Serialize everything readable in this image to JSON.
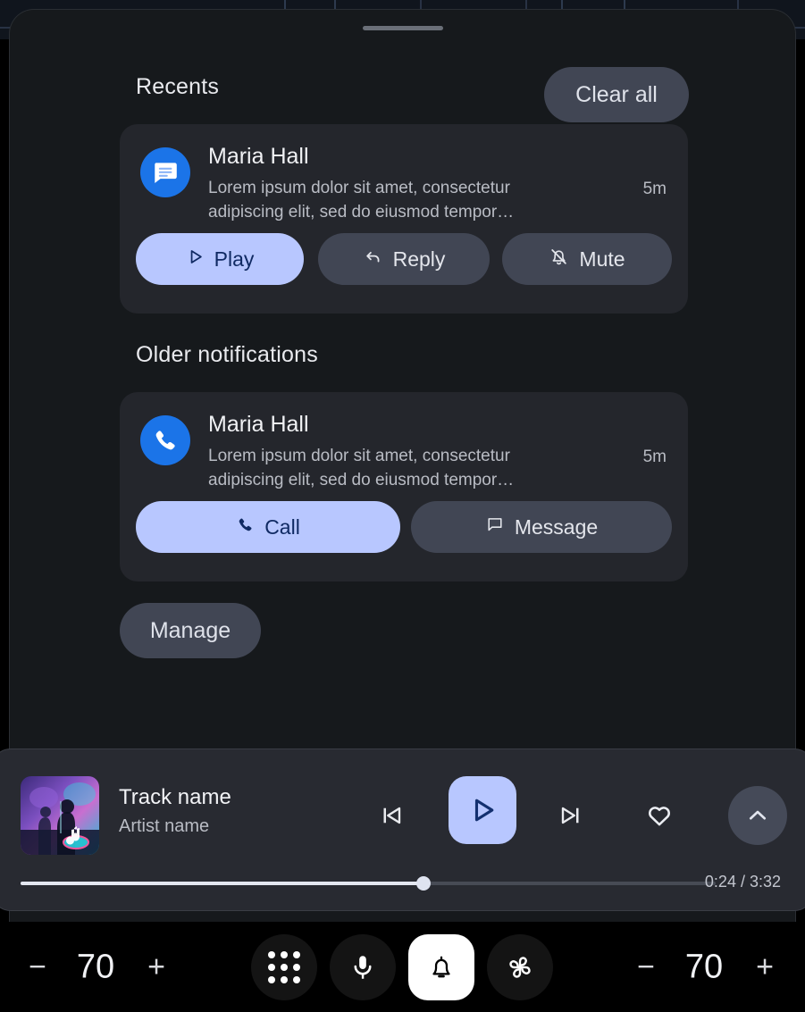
{
  "sheet": {
    "drag_handle": "drag-handle",
    "recents_header": "Recents",
    "clear_all_label": "Clear all",
    "older_header": "Older notifications",
    "manage_label": "Manage"
  },
  "notifications": [
    {
      "group": "Recents",
      "app_icon": "messages-icon",
      "title": "Maria Hall",
      "body": "Lorem ipsum dolor sit amet, consectetur adipiscing elit, sed do eiusmod tempor…",
      "time": "5m",
      "actions": [
        {
          "label": "Play",
          "icon": "play-icon",
          "style": "filled"
        },
        {
          "label": "Reply",
          "icon": "reply-icon",
          "style": "tonal"
        },
        {
          "label": "Mute",
          "icon": "bell-off-icon",
          "style": "tonal"
        }
      ]
    },
    {
      "group": "Older notifications",
      "app_icon": "phone-icon",
      "title": "Maria Hall",
      "body": "Lorem ipsum dolor sit amet, consectetur adipiscing elit, sed do eiusmod tempor…",
      "time": "5m",
      "actions": [
        {
          "label": "Call",
          "icon": "phone-icon",
          "style": "filled"
        },
        {
          "label": "Message",
          "icon": "message-icon",
          "style": "tonal"
        }
      ]
    }
  ],
  "media": {
    "track_name": "Track name",
    "artist_name": "Artist name",
    "album_art": "concert-photo",
    "controls": {
      "prev": "skip-previous-icon",
      "play": "play-icon",
      "next": "skip-next-icon",
      "favorite": "heart-icon",
      "expand": "chevron-up-icon"
    },
    "elapsed": "0:24",
    "duration": "3:32",
    "time_label": "0:24 / 3:32",
    "progress_percent": 58
  },
  "bottom_bar": {
    "temp_left": {
      "minus": "−",
      "value": "70",
      "plus": "+"
    },
    "temp_right": {
      "minus": "−",
      "value": "70",
      "plus": "+"
    },
    "nav": [
      {
        "name": "apps",
        "icon": "apps-grid-icon",
        "active": false
      },
      {
        "name": "mic",
        "icon": "microphone-icon",
        "active": false
      },
      {
        "name": "notif",
        "icon": "bell-icon",
        "active": true
      },
      {
        "name": "climate",
        "icon": "fan-icon",
        "active": false
      }
    ]
  },
  "colors": {
    "background": "#000000",
    "sheet": "#16191c",
    "card": "#24262c",
    "tonal_chip": "#414654",
    "accent_filled": "#b8c7ff",
    "accent_on_filled": "#102a63",
    "app_blue": "#1b74e8",
    "media_panel": "#282a31"
  }
}
